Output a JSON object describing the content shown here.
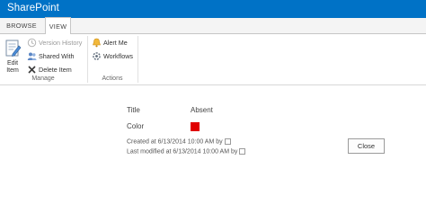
{
  "app": {
    "title": "SharePoint",
    "brand_color": "#0072c6"
  },
  "tabs": [
    {
      "label": "BROWSE",
      "selected": false
    },
    {
      "label": "VIEW",
      "selected": true
    }
  ],
  "ribbon": {
    "manage": {
      "group_label": "Manage",
      "edit_item": {
        "label_line1": "Edit",
        "label_line2": "Item",
        "icon": "edit-item-icon"
      },
      "version_history": {
        "label": "Version History",
        "icon": "version-history-icon",
        "enabled": false
      },
      "shared_with": {
        "label": "Shared With",
        "icon": "shared-with-icon"
      },
      "delete_item": {
        "label": "Delete Item",
        "icon": "delete-icon"
      }
    },
    "actions": {
      "group_label": "Actions",
      "alert_me": {
        "label": "Alert Me",
        "icon": "bell-icon"
      },
      "workflows": {
        "label": "Workflows",
        "icon": "workflows-icon"
      }
    }
  },
  "form": {
    "title_label": "Title",
    "title_value": "Absent",
    "color_label": "Color",
    "color_value_hex": "#e00000",
    "created_text": "Created at 6/13/2014 10:00 AM  by",
    "modified_text": "Last modified at 6/13/2014 10:00 AM  by",
    "close_label": "Close"
  }
}
